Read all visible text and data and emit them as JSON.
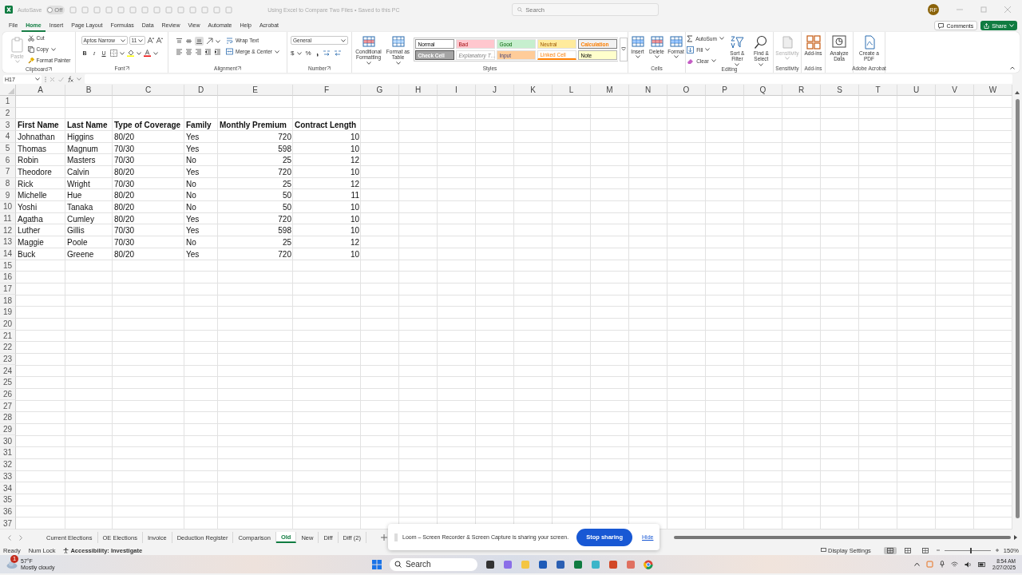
{
  "titlebar": {
    "autosave_label": "AutoSave",
    "autosave_on": false,
    "autosave_state": "Off",
    "title": "Using Excel to Compare Two Files • Saved to this PC",
    "search_placeholder": "Search",
    "user_initials": "RF"
  },
  "ribbon": {
    "tabs": [
      {
        "label": "File",
        "selected": false
      },
      {
        "label": "Home",
        "selected": true
      },
      {
        "label": "Insert",
        "selected": false
      },
      {
        "label": "Page Layout",
        "selected": false
      },
      {
        "label": "Formulas",
        "selected": false
      },
      {
        "label": "Data",
        "selected": false
      },
      {
        "label": "Review",
        "selected": false
      },
      {
        "label": "View",
        "selected": false
      },
      {
        "label": "Automate",
        "selected": false
      },
      {
        "label": "Help",
        "selected": false
      },
      {
        "label": "Acrobat",
        "selected": false
      }
    ],
    "comments": "Comments",
    "share": "Share",
    "groups": [
      {
        "kind": "clipboard",
        "label": "Clipboard",
        "items": [
          {
            "label": "Paste",
            "disabled": true
          },
          {
            "label": "Cut",
            "disabled": false
          },
          {
            "label": "Copy",
            "disabled": false
          },
          {
            "label": "Format Painter",
            "disabled": false
          }
        ]
      },
      {
        "kind": "font",
        "label": "Font",
        "font": "Aptos Narrow",
        "size": "11",
        "buttons": [
          "B",
          "I",
          "U"
        ]
      },
      {
        "kind": "alignment",
        "label": "Alignment",
        "items": [
          {
            "label": "Wrap Text",
            "disabled": false
          },
          {
            "label": "Merge & Center",
            "disabled": false
          }
        ]
      },
      {
        "kind": "number",
        "label": "Number",
        "format": "General",
        "buttons": [
          "$",
          "%"
        ]
      },
      {
        "kind": "styles",
        "label": "Styles",
        "items": [
          {
            "label": "Conditional Formatting",
            "disabled": false
          },
          {
            "label": "Format as Table",
            "disabled": false
          }
        ],
        "cell_styles": [
          {
            "label": "Normal",
            "kind": "normal",
            "color": "#ffffff"
          },
          {
            "label": "Bad",
            "kind": "bad",
            "color": "#ffc7ce"
          },
          {
            "label": "Good",
            "kind": "good",
            "color": "#c6efce"
          },
          {
            "label": "Neutral",
            "kind": "neutral",
            "color": "#ffeb9c"
          },
          {
            "label": "Calculation",
            "kind": "calculation",
            "color": "#f2f2f2"
          },
          {
            "label": "Check Cell",
            "kind": "check",
            "color": "#a5a5a5"
          },
          {
            "label": "Explanatory T…",
            "kind": "explanatory",
            "color": "#ffffff"
          },
          {
            "label": "Input",
            "kind": "input",
            "color": "#ffcc99"
          },
          {
            "label": "Linked Cell",
            "kind": "linked",
            "color": "#ffffff"
          },
          {
            "label": "Note",
            "kind": "note",
            "color": "#ffffcc"
          }
        ]
      },
      {
        "kind": "cells",
        "label": "Cells",
        "items": [
          {
            "label": "Insert",
            "disabled": false
          },
          {
            "label": "Delete",
            "disabled": false
          },
          {
            "label": "Format",
            "disabled": false
          }
        ]
      },
      {
        "kind": "editing",
        "label": "Editing",
        "items": [
          {
            "label": "AutoSum",
            "disabled": false
          },
          {
            "label": "Fill",
            "disabled": false
          },
          {
            "label": "Clear",
            "disabled": false
          },
          {
            "label": "Sort & Filter",
            "disabled": false
          },
          {
            "label": "Find & Select",
            "disabled": false
          }
        ]
      },
      {
        "kind": "large",
        "label": "Sensitivity",
        "items": [
          {
            "label": "Sensitivity",
            "disabled": true
          }
        ]
      },
      {
        "kind": "large",
        "label": "Add-ins",
        "items": [
          {
            "label": "Add-ins",
            "disabled": false
          }
        ]
      },
      {
        "kind": "large",
        "items": [
          {
            "label": "Analyze Data",
            "disabled": false
          }
        ]
      },
      {
        "kind": "large",
        "label": "Adobe Acrobat",
        "items": [
          {
            "label": "Create a PDF",
            "disabled": false
          }
        ]
      }
    ]
  },
  "formula_bar": {
    "name_box": "H17"
  },
  "sheet": {
    "columns": [
      {
        "letter": "A",
        "kind": "text"
      },
      {
        "letter": "B",
        "kind": "text"
      },
      {
        "letter": "C",
        "kind": "text"
      },
      {
        "letter": "D",
        "kind": "text"
      },
      {
        "letter": "E",
        "kind": "number"
      },
      {
        "letter": "F",
        "kind": "number"
      },
      {
        "letter": "G"
      },
      {
        "letter": "H"
      },
      {
        "letter": "I"
      },
      {
        "letter": "J"
      },
      {
        "letter": "K"
      },
      {
        "letter": "L"
      },
      {
        "letter": "M"
      },
      {
        "letter": "N"
      },
      {
        "letter": "O"
      },
      {
        "letter": "P"
      },
      {
        "letter": "Q"
      },
      {
        "letter": "R"
      },
      {
        "letter": "S"
      },
      {
        "letter": "T"
      },
      {
        "letter": "U"
      },
      {
        "letter": "V"
      },
      {
        "letter": "W"
      }
    ],
    "rows": [
      {
        "number": "1"
      },
      {
        "number": "2"
      },
      {
        "number": "3",
        "kind": "header",
        "cells": [
          "First Name",
          "Last Name",
          "Type of Coverage",
          "Family",
          "Monthly Premium",
          "Contract Length"
        ]
      },
      {
        "number": "4",
        "kind": "data",
        "cells": [
          "Johnathan",
          "Higgins",
          "80/20",
          "Yes",
          "720",
          "10"
        ]
      },
      {
        "number": "5",
        "kind": "data",
        "cells": [
          "Thomas",
          "Magnum",
          "70/30",
          "Yes",
          "598",
          "10"
        ]
      },
      {
        "number": "6",
        "kind": "data",
        "cells": [
          "Robin",
          "Masters",
          "70/30",
          "No",
          "25",
          "12"
        ]
      },
      {
        "number": "7",
        "kind": "data",
        "cells": [
          "Theodore",
          "Calvin",
          "80/20",
          "Yes",
          "720",
          "10"
        ]
      },
      {
        "number": "8",
        "kind": "data",
        "cells": [
          "Rick",
          "Wright",
          "70/30",
          "No",
          "25",
          "12"
        ]
      },
      {
        "number": "9",
        "kind": "data",
        "cells": [
          "Michelle",
          "Hue",
          "80/20",
          "No",
          "50",
          "11"
        ]
      },
      {
        "number": "10",
        "kind": "data",
        "cells": [
          "Yoshi",
          "Tanaka",
          "80/20",
          "No",
          "50",
          "10"
        ]
      },
      {
        "number": "11",
        "kind": "data",
        "cells": [
          "Agatha",
          "Cumley",
          "80/20",
          "Yes",
          "720",
          "10"
        ]
      },
      {
        "number": "12",
        "kind": "data",
        "cells": [
          "Luther",
          "Gillis",
          "70/30",
          "Yes",
          "598",
          "10"
        ]
      },
      {
        "number": "13",
        "kind": "data",
        "cells": [
          "Maggie",
          "Poole",
          "70/30",
          "No",
          "25",
          "12"
        ]
      },
      {
        "number": "14",
        "kind": "data",
        "cells": [
          "Buck",
          "Greene",
          "80/20",
          "Yes",
          "720",
          "10"
        ]
      },
      {
        "number": "15"
      },
      {
        "number": "16"
      },
      {
        "number": "17"
      },
      {
        "number": "18"
      },
      {
        "number": "19"
      },
      {
        "number": "20"
      },
      {
        "number": "21"
      },
      {
        "number": "22"
      },
      {
        "number": "23"
      },
      {
        "number": "24"
      },
      {
        "number": "25"
      },
      {
        "number": "26"
      },
      {
        "number": "27"
      },
      {
        "number": "28"
      },
      {
        "number": "29"
      },
      {
        "number": "30"
      },
      {
        "number": "31"
      },
      {
        "number": "32"
      },
      {
        "number": "33"
      },
      {
        "number": "34"
      },
      {
        "number": "35"
      },
      {
        "number": "36"
      },
      {
        "number": "37"
      }
    ]
  },
  "sheet_tabs": [
    {
      "label": "Current Elections",
      "selected": false
    },
    {
      "label": "OE Elections",
      "selected": false
    },
    {
      "label": "Invoice",
      "selected": false
    },
    {
      "label": "Deduction Register",
      "selected": false
    },
    {
      "label": "Comparison",
      "selected": false
    },
    {
      "label": "Old",
      "selected": true
    },
    {
      "label": "New",
      "selected": false
    },
    {
      "label": "Diff",
      "selected": false
    },
    {
      "label": "Diff (2)",
      "selected": false
    }
  ],
  "status_bar": {
    "items": [
      "Ready",
      "Num Lock"
    ],
    "accessibility": "Accessibility: Investigate",
    "display_settings": "Display Settings",
    "views": [
      {
        "selected": true
      },
      {
        "selected": false
      },
      {
        "selected": false
      }
    ],
    "zoom": {
      "level": 0.55,
      "label": "150%"
    }
  },
  "loom": {
    "message": "Loom – Screen Recorder & Screen Capture is sharing your screen.",
    "stop": "Stop sharing",
    "hide": "Hide"
  },
  "taskbar": {
    "weather": {
      "badge": "1",
      "temp": "57°F",
      "condition": "Mostly cloudy"
    },
    "search": "Search",
    "time": "8:54 AM",
    "date": "2/27/2025"
  }
}
